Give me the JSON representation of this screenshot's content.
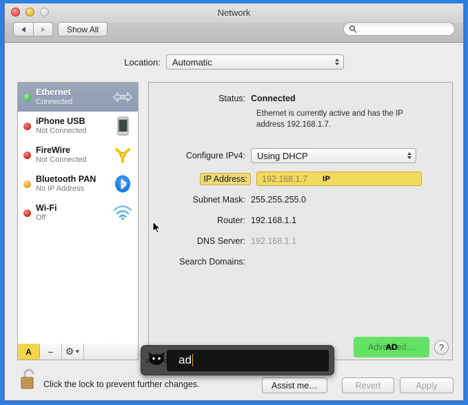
{
  "window": {
    "title": "Network",
    "traffic_lights": [
      "close",
      "minimize",
      "zoom"
    ]
  },
  "toolbar": {
    "back_label": "◀",
    "forward_label": "▶",
    "show_all_label": "Show All",
    "search_placeholder": "",
    "search_value": ""
  },
  "location": {
    "label": "Location:",
    "selected": "Automatic"
  },
  "sidebar": {
    "interfaces": [
      {
        "name": "Ethernet",
        "status": "Connected",
        "dot": "#4cd04c",
        "icon": "ethernet-icon",
        "selected": true
      },
      {
        "name": "iPhone USB",
        "status": "Not Connected",
        "dot": "#d83a2e",
        "icon": "iphone-icon",
        "selected": false
      },
      {
        "name": "FireWire",
        "status": "Not Connected",
        "dot": "#d83a2e",
        "icon": "firewire-icon",
        "selected": false
      },
      {
        "name": "Bluetooth PAN",
        "status": "No IP Address",
        "dot": "#f0b429",
        "icon": "bluetooth-icon",
        "selected": false
      },
      {
        "name": "Wi-Fi",
        "status": "Off",
        "dot": "#d83a2e",
        "icon": "wifi-icon",
        "selected": false
      }
    ],
    "toolbar": {
      "add_label": "A",
      "remove_label": "−",
      "gear_label": "⚙"
    }
  },
  "main": {
    "status_label": "Status:",
    "status_value": "Connected",
    "status_description": "Ethernet is currently active and has the IP address 192.168.1.7.",
    "configure_label": "Configure IPv4:",
    "configure_value": "Using DHCP",
    "ip_label": "IP Address:",
    "ip_value": "192.168.1.7",
    "ip_hint": "IP",
    "subnet_label": "Subnet Mask:",
    "subnet_value": "255.255.255.0",
    "router_label": "Router:",
    "router_value": "192.168.1.1",
    "dns_label": "DNS Server:",
    "dns_value": "192.168.1.1",
    "search_domains_label": "Search Domains:",
    "search_domains_value": "",
    "advanced_label": "Advanced…",
    "advanced_hint": "AD",
    "help_label": "?"
  },
  "bottom": {
    "lock_text": "Click the lock to prevent further changes.",
    "assist_me_label": "Assist me…",
    "revert_label": "Revert",
    "apply_label": "Apply"
  },
  "shortcat": {
    "query": "ad"
  },
  "colors": {
    "hint_yellow": "#f2d95f",
    "hint_green": "#61e461",
    "selection_blue": "#9aa7bd",
    "frame_blue": "#2f7fe0"
  }
}
